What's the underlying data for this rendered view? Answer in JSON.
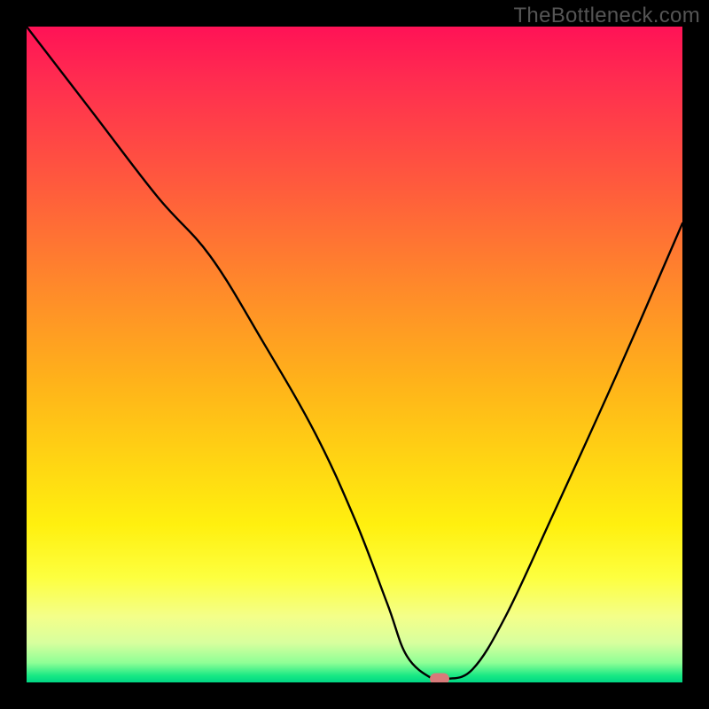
{
  "watermark": "TheBottleneck.com",
  "chart_data": {
    "type": "line",
    "title": "",
    "xlabel": "",
    "ylabel": "",
    "xlim": [
      0,
      100
    ],
    "ylim": [
      0,
      100
    ],
    "grid": false,
    "series": [
      {
        "name": "bottleneck-curve",
        "x": [
          0,
          10,
          20,
          28,
          36,
          44,
          50,
          55,
          58,
          62,
          64,
          68,
          73,
          80,
          90,
          100
        ],
        "values": [
          100,
          87,
          74,
          65,
          52,
          38,
          25,
          12,
          4,
          0.5,
          0.5,
          2,
          10,
          25,
          47,
          70
        ]
      }
    ],
    "marker": {
      "x": 63,
      "y": 0.5
    },
    "gradient_stops": [
      {
        "pos": 0,
        "color": "#ff1256"
      },
      {
        "pos": 40,
        "color": "#ff8a2a"
      },
      {
        "pos": 76,
        "color": "#fff00f"
      },
      {
        "pos": 100,
        "color": "#00d684"
      }
    ]
  }
}
